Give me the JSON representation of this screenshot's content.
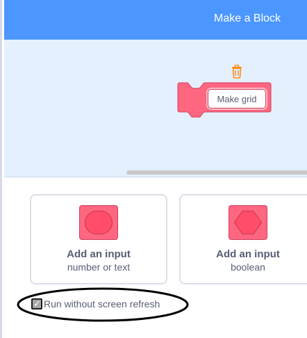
{
  "header": {
    "title": "Make a Block",
    "color": "#4c97ff"
  },
  "workspace": {
    "background": "#e5f0ff",
    "trash_icon": "trash-icon",
    "block": {
      "name": "Make grid",
      "color": "#ff6680"
    }
  },
  "options": [
    {
      "title": "Add an input",
      "subtitle": "number or text",
      "icon": "rounded-input-icon"
    },
    {
      "title": "Add an input",
      "subtitle": "boolean",
      "icon": "boolean-input-icon"
    }
  ],
  "run_without_refresh": {
    "label": "Run without screen refresh",
    "checked": true
  },
  "annotation": {
    "type": "ellipse",
    "color": "#000000"
  }
}
